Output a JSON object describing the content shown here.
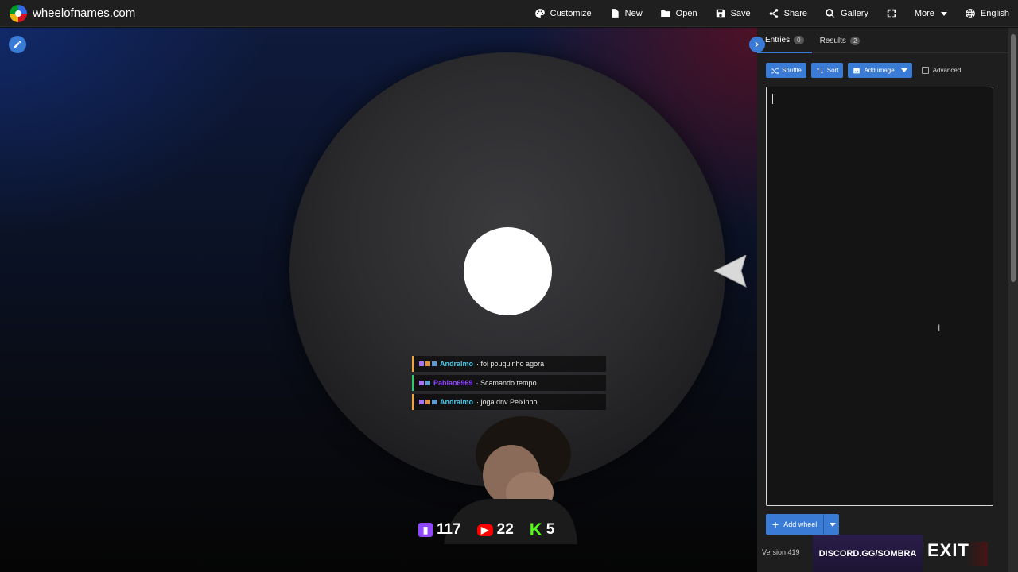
{
  "site": {
    "name": "wheelofnames.com"
  },
  "menu": [
    {
      "label": "Customize",
      "icon": "palette-icon"
    },
    {
      "label": "New",
      "icon": "file-icon"
    },
    {
      "label": "Open",
      "icon": "folder-icon"
    },
    {
      "label": "Save",
      "icon": "save-icon"
    },
    {
      "label": "Share",
      "icon": "share-icon"
    },
    {
      "label": "Gallery",
      "icon": "search-icon"
    },
    {
      "label": "",
      "icon": "fullscreen-icon"
    },
    {
      "label": "More",
      "icon": "caret-down-icon"
    },
    {
      "label": "English",
      "icon": "globe-icon"
    }
  ],
  "tabs": {
    "entries": {
      "label": "Entries",
      "count": "0"
    },
    "results": {
      "label": "Results",
      "count": "2"
    }
  },
  "toolbar": {
    "shuffle": "Shuffle",
    "sort": "Sort",
    "add_image": "Add image",
    "advanced": "Advanced"
  },
  "add_wheel": {
    "label": "Add wheel"
  },
  "version": "Version 419",
  "chat": [
    {
      "user": "Andralmo",
      "text": "· foi pouquinho agora"
    },
    {
      "user": "Pablao6969",
      "text": "· Scamando tempo"
    },
    {
      "user": "Andralmo",
      "text": "· joga dnv Peixinho"
    }
  ],
  "stats": {
    "twitch": "117",
    "youtube": "22",
    "kick": "5"
  },
  "overlay": {
    "discord": "DISCORD.GG/SOMBRA",
    "exit": "EXIT"
  },
  "colors": {
    "accent": "#3a7bd5",
    "panel": "#1e1e1e",
    "topbar": "#1f1f1f"
  }
}
